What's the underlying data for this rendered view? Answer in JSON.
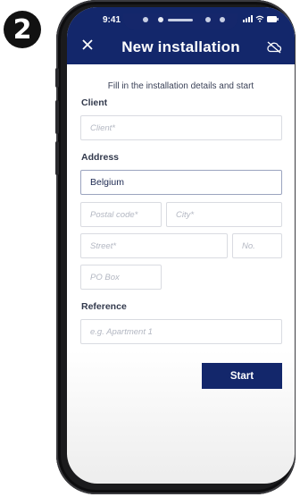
{
  "step": {
    "number": "2"
  },
  "status_bar": {
    "time": "9:41"
  },
  "header": {
    "title": "New installation",
    "close_icon": "close-icon",
    "cloud_icon": "cloud-off-icon"
  },
  "form": {
    "subtitle": "Fill in the installation details and start",
    "client": {
      "label": "Client",
      "placeholder": "Client*"
    },
    "address": {
      "label": "Address",
      "country": "Belgium",
      "postal_code": "Postal code*",
      "city": "City*",
      "street": "Street*",
      "number": "No.",
      "po_box": "PO Box"
    },
    "reference": {
      "label": "Reference",
      "placeholder": "e.g. Apartment 1"
    },
    "start_label": "Start"
  },
  "colors": {
    "brand": "#13276b"
  }
}
